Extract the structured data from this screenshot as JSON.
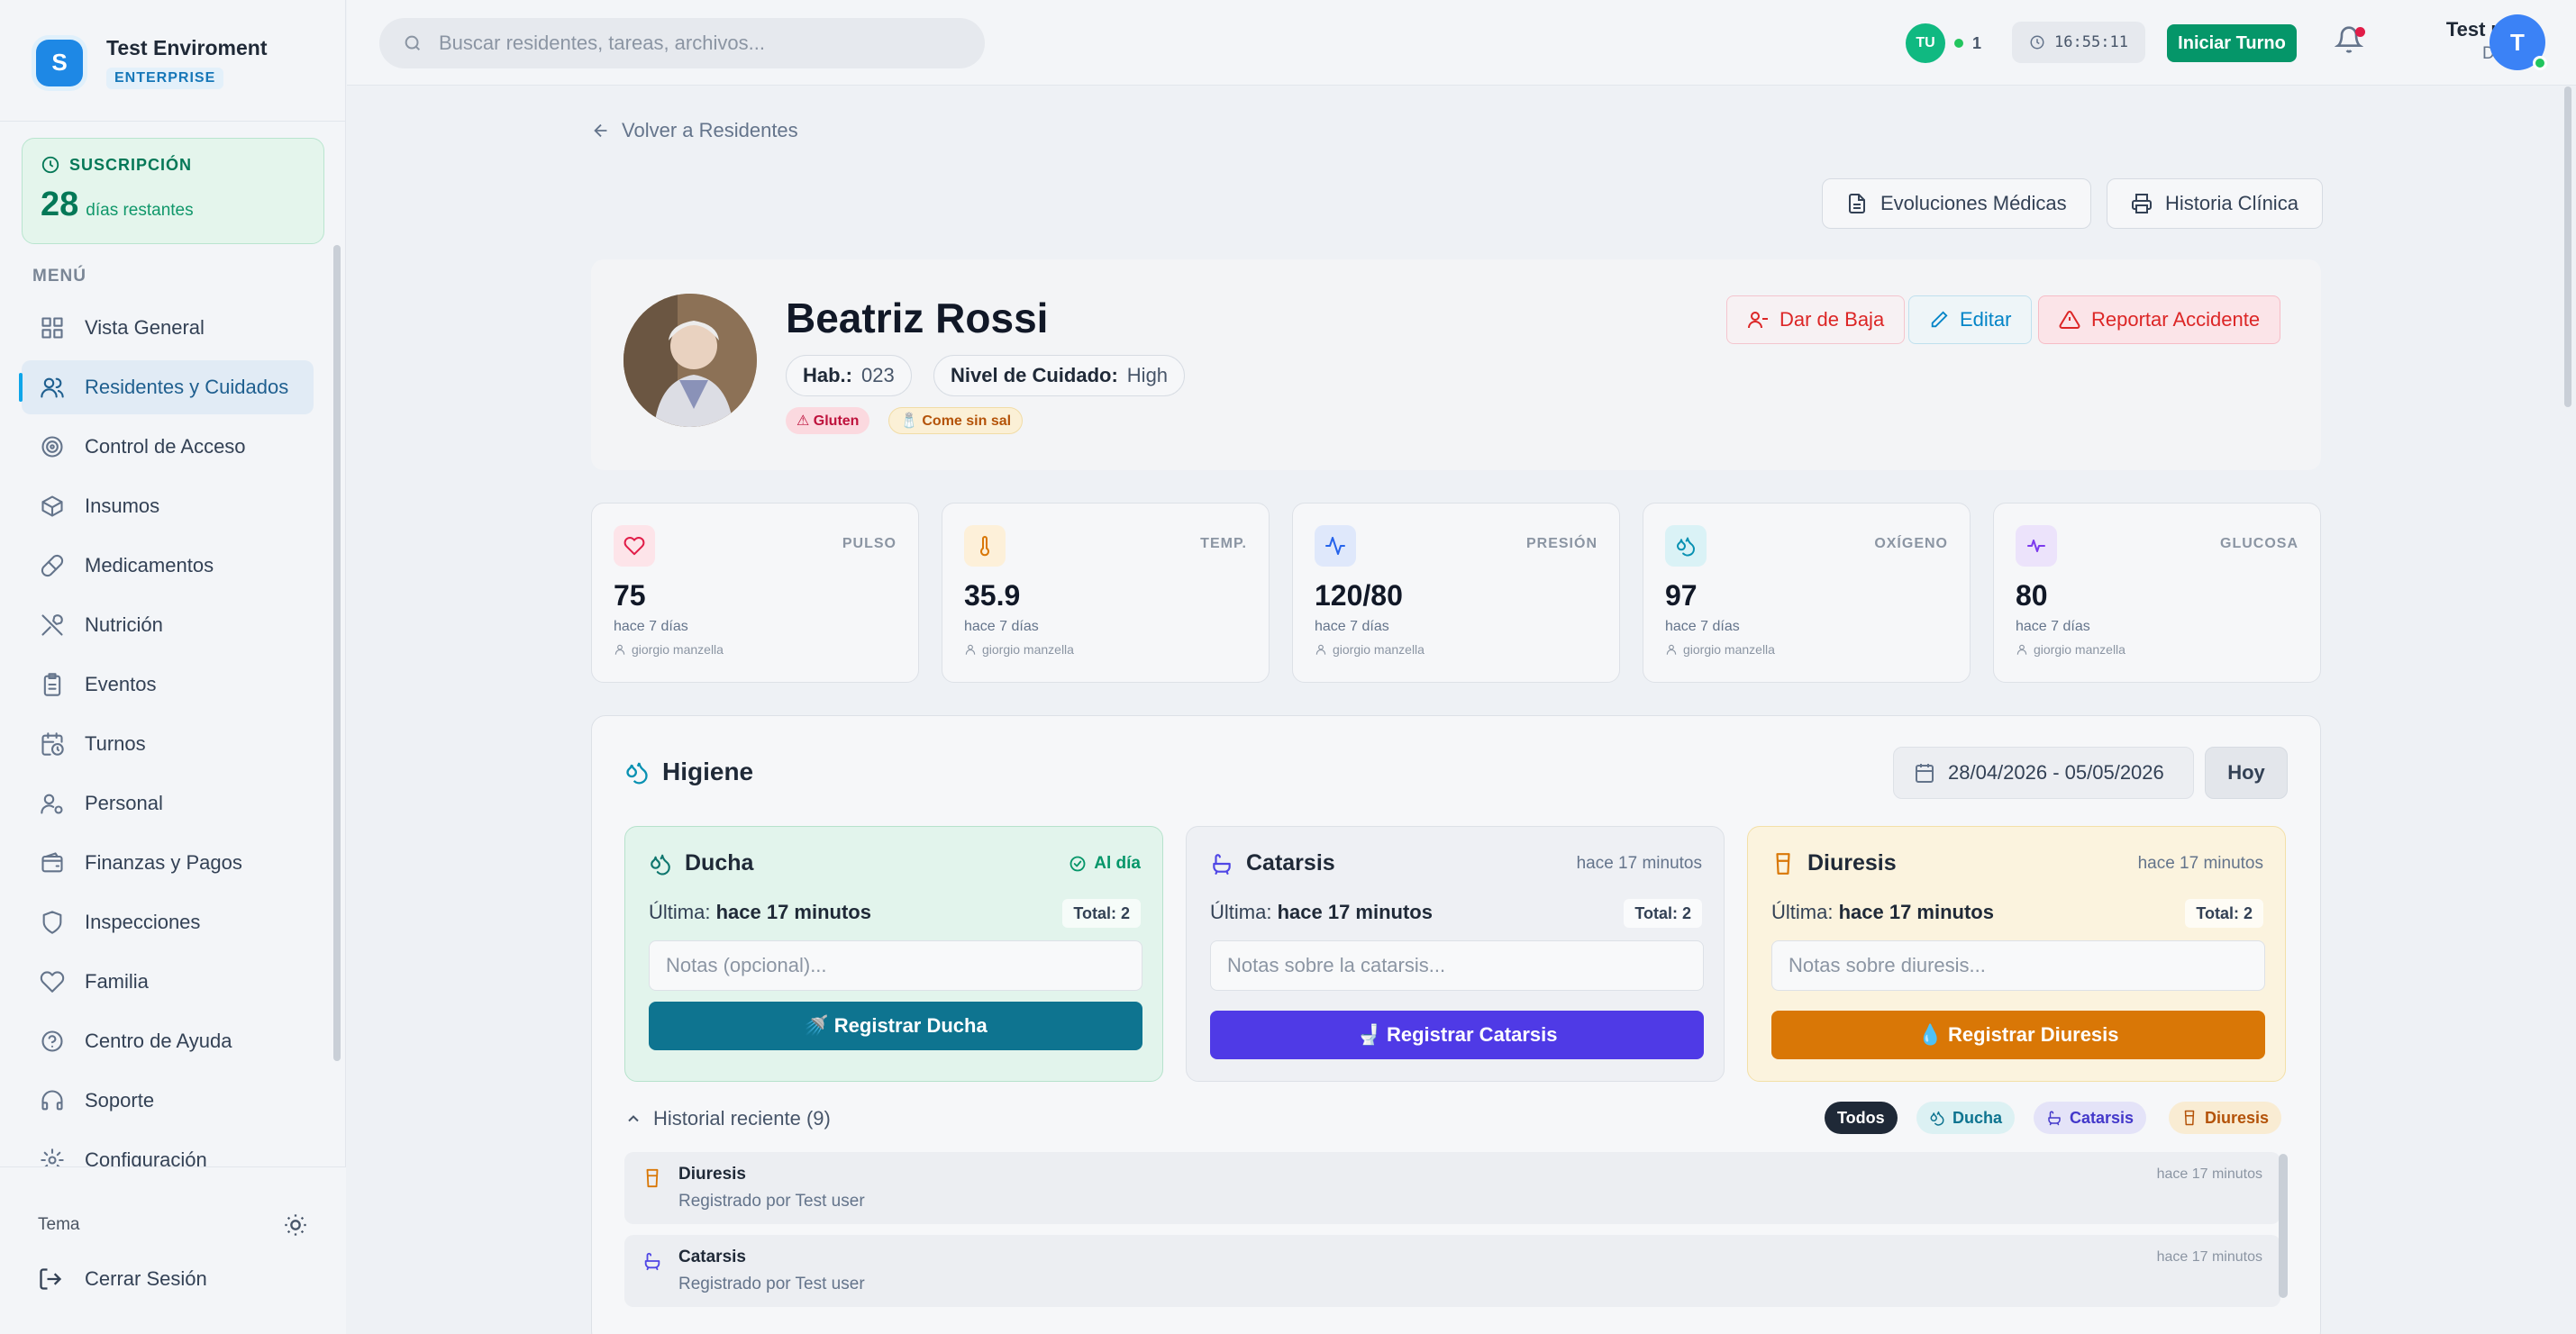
{
  "brand": {
    "name": "Test Enviroment",
    "badge": "ENTERPRISE",
    "logo_letter": "S"
  },
  "subscription": {
    "title": "SUSCRIPCIÓN",
    "days": "28",
    "days_label": "días restantes"
  },
  "menu": {
    "label": "MENÚ",
    "items": [
      {
        "label": "Vista General",
        "icon": "grid-icon"
      },
      {
        "label": "Residentes y Cuidados",
        "icon": "users-icon",
        "active": true
      },
      {
        "label": "Control de Acceso",
        "icon": "target-icon"
      },
      {
        "label": "Insumos",
        "icon": "box-icon"
      },
      {
        "label": "Medicamentos",
        "icon": "pill-icon"
      },
      {
        "label": "Nutrición",
        "icon": "utensils-icon"
      },
      {
        "label": "Eventos",
        "icon": "clipboard-icon"
      },
      {
        "label": "Turnos",
        "icon": "calendar-clock-icon"
      },
      {
        "label": "Personal",
        "icon": "user-gear-icon"
      },
      {
        "label": "Finanzas y Pagos",
        "icon": "wallet-icon"
      },
      {
        "label": "Inspecciones",
        "icon": "shield-icon"
      },
      {
        "label": "Familia",
        "icon": "heart-icon"
      },
      {
        "label": "Centro de Ayuda",
        "icon": "help-circle-icon"
      },
      {
        "label": "Soporte",
        "icon": "headset-icon"
      },
      {
        "label": "Configuración",
        "icon": "settings-icon"
      }
    ]
  },
  "sidebar_bottom": {
    "theme_label": "Tema",
    "logout_label": "Cerrar Sesión"
  },
  "topbar": {
    "search_placeholder": "Buscar residentes, tareas, archivos...",
    "online_initials": "TU",
    "online_count": "1",
    "clock": "16:55:11",
    "shift_button": "Iniciar Turno",
    "user_name": "Test user",
    "user_role": "Dueño",
    "user_initial": "T"
  },
  "page": {
    "back_label": "Volver a Residentes",
    "evolutions_button": "Evoluciones Médicas",
    "history_button": "Historia Clínica"
  },
  "resident": {
    "name": "Beatriz Rossi",
    "room_label": "Hab.:",
    "room": "023",
    "care_label": "Nivel de Cuidado:",
    "care": "High",
    "tags": [
      "⚠ Gluten",
      "🧂 Come sin sal"
    ],
    "actions": {
      "discharge": "Dar de Baja",
      "edit": "Editar",
      "accident": "Reportar Accidente"
    }
  },
  "vitals": [
    {
      "label": "PULSO",
      "value": "75",
      "time": "hace 7 días",
      "user": "giorgio manzella",
      "icon": "heart-icon",
      "color": "#e11d48",
      "bg": "#fde4e9"
    },
    {
      "label": "TEMP.",
      "value": "35.9",
      "time": "hace 7 días",
      "user": "giorgio manzella",
      "icon": "thermometer-icon",
      "color": "#d97706",
      "bg": "#fdf0d9"
    },
    {
      "label": "PRESIÓN",
      "value": "120/80",
      "time": "hace 7 días",
      "user": "giorgio manzella",
      "icon": "activity-icon",
      "color": "#2563eb",
      "bg": "#dfe8fb"
    },
    {
      "label": "OXÍGENO",
      "value": "97",
      "time": "hace 7 días",
      "user": "giorgio manzella",
      "icon": "droplets-icon",
      "color": "#0891b2",
      "bg": "#daf2f6"
    },
    {
      "label": "GLUCOSA",
      "value": "80",
      "time": "hace 7 días",
      "user": "giorgio manzella",
      "icon": "pulse-icon",
      "color": "#7c3aed",
      "bg": "#ece3fb"
    }
  ],
  "hygiene": {
    "title": "Higiene",
    "date_range": "28/04/2026 - 05/05/2026",
    "today_button": "Hoy",
    "cards": [
      {
        "title": "Ducha",
        "status": "Al día",
        "last_label": "Última:",
        "last": "hace 17 minutos",
        "total": "Total: 2",
        "placeholder": "Notas (opcional)...",
        "button": "🚿 Registrar Ducha",
        "icon": "droplets-icon",
        "color": "#0f766e",
        "bg": "#e2f4ec",
        "border": "#b6e2cc",
        "btn_color": "#0e7490"
      },
      {
        "title": "Catarsis",
        "status": "hace 17 minutos",
        "last_label": "Última:",
        "last": "hace 17 minutos",
        "total": "Total: 2",
        "placeholder": "Notas sobre la catarsis...",
        "button": "🚽 Registrar Catarsis",
        "icon": "bath-icon",
        "color": "#4f46e5",
        "bg": "#eef0f4",
        "border": "#dde1e7",
        "btn_color": "#4f3ae6"
      },
      {
        "title": "Diuresis",
        "status": "hace 17 minutos",
        "last_label": "Última:",
        "last": "hace 17 minutos",
        "total": "Total: 2",
        "placeholder": "Notas sobre diuresis...",
        "button": "💧 Registrar Diuresis",
        "icon": "cup-icon",
        "color": "#d97706",
        "bg": "#fbf3de",
        "border": "#f3e0a8",
        "btn_color": "#d97706"
      }
    ],
    "history_title": "Historial reciente (9)",
    "filters": [
      {
        "label": "Todos",
        "bg": "#1f2937",
        "color": "#ffffff"
      },
      {
        "label": "Ducha",
        "bg": "#dcf1f3",
        "color": "#0e7490"
      },
      {
        "label": "Catarsis",
        "bg": "#e4e3f8",
        "color": "#4338ca"
      },
      {
        "label": "Diuresis",
        "bg": "#f9ecd3",
        "color": "#b45309"
      }
    ],
    "history": [
      {
        "title": "Diuresis",
        "sub": "Registrado por Test user",
        "time": "hace 17 minutos",
        "icon": "cup-icon",
        "color": "#d97706"
      },
      {
        "title": "Catarsis",
        "sub": "Registrado por Test user",
        "time": "hace 17 minutos",
        "icon": "bath-icon",
        "color": "#4f46e5"
      }
    ]
  }
}
